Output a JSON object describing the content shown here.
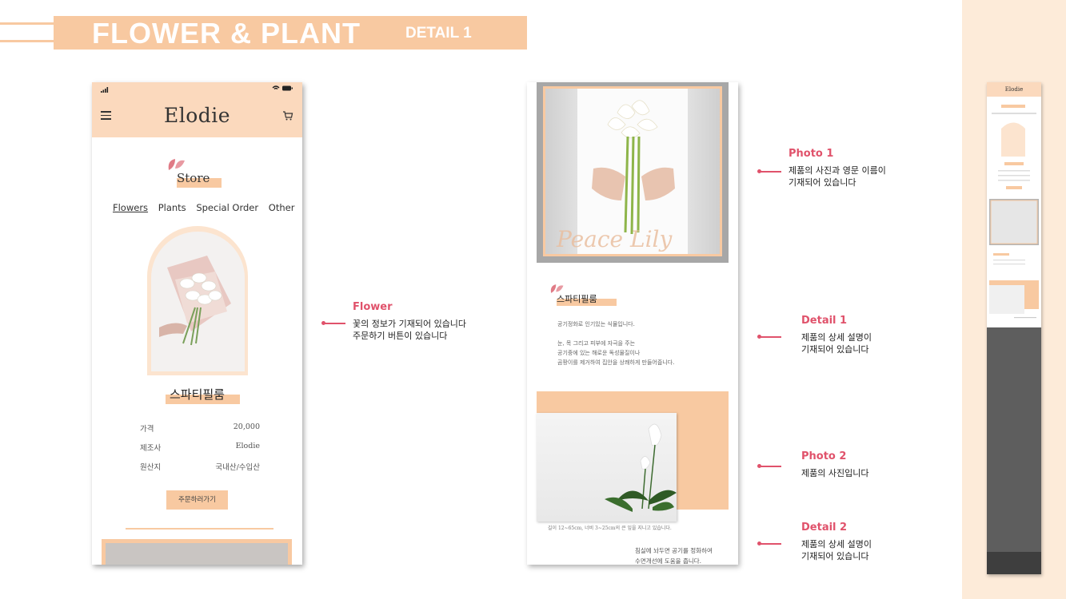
{
  "header": {
    "title": "FLOWER & PLANT",
    "subtitle": "DETAIL 1"
  },
  "phone": {
    "brand": "Elodie",
    "status_right": "◔ ▬",
    "store_label": "Store",
    "tabs": [
      "Flowers",
      "Plants",
      "Special Order",
      "Other"
    ],
    "active_tab": "Flowers",
    "product_name": "스파티필룸",
    "info": [
      {
        "key": "가격",
        "value": "20,000"
      },
      {
        "key": "제조사",
        "value": "Elodie"
      },
      {
        "key": "원산지",
        "value": "국내산/수입산"
      }
    ],
    "order_button": "주문하러가기"
  },
  "annotations": {
    "flower": {
      "title": "Flower",
      "lines": [
        "꽃의 정보가 기재되어 있습니다",
        "주문하기 버튼이 있습니다"
      ]
    },
    "photo1": {
      "title": "Photo 1",
      "lines": [
        "제품의 사진과 영문 이름이",
        "기재되어 있습니다"
      ]
    },
    "detail1": {
      "title": "Detail 1",
      "lines": [
        "제품의 상세 설명이",
        "기재되어 있습니다"
      ]
    },
    "photo2": {
      "title": "Photo 2",
      "lines": [
        "제품의 사진입니다"
      ]
    },
    "detail2": {
      "title": "Detail 2",
      "lines": [
        "제품의 상세 설명이",
        "기재되어 있습니다"
      ]
    }
  },
  "detail_page": {
    "photo_caption": "Peace Lily",
    "title": "스파티필룸",
    "paragraph1": [
      "공기정화로 인기있는 식물입니다."
    ],
    "paragraph2": [
      "눈, 목 그리고 피부에 자극을 주는",
      "공기중에 있는 해로운 독성물질이나",
      "곰팡이를 제거하여 집안을 상쾌하게 만들어줍니다."
    ],
    "photo2_caption": "길이 12~65cm, 너비 3~25cm의 큰 잎을 지니고 있습니다.",
    "paragraph3": [
      "침실에 놔두면 공기를 정화하여",
      "수면개선에 도움을 줍니다."
    ]
  },
  "thumbnail": {
    "brand": "Elodie"
  },
  "colors": {
    "accent_peach": "#f8c9a1",
    "light_peach": "#fbd9bd",
    "annotation_pink": "#e0526b",
    "panel_bg": "#fdebd9"
  }
}
